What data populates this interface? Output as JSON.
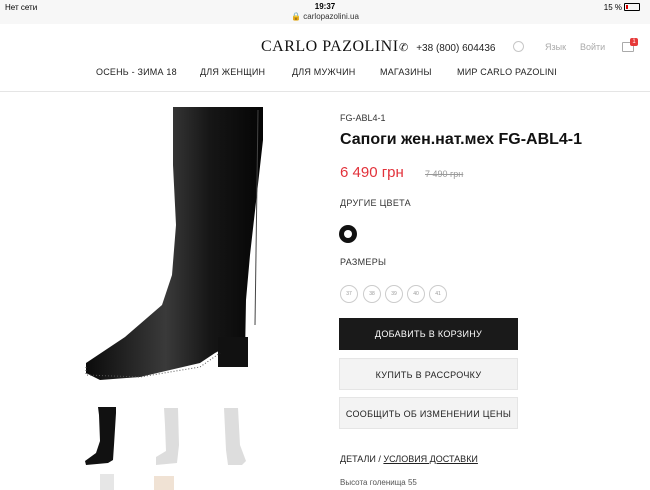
{
  "statusbar": {
    "carrier": "Нет сети",
    "time": "19:37",
    "url": "carlopazolini.ua",
    "battery": "15 %"
  },
  "header": {
    "logo": "CARLO PAZOLINI",
    "phone": "+38 (800) 604436",
    "lang": "Язык",
    "login": "Войти",
    "cart_count": "1"
  },
  "nav": [
    "ОСЕНЬ - ЗИМА 18",
    "ДЛЯ ЖЕНЩИН",
    "ДЛЯ МУЖЧИН",
    "МАГАЗИНЫ",
    "МИР CARLO PAZOLINI"
  ],
  "product": {
    "sku": "FG-ABL4-1",
    "title": "Сапоги жен.нат.мех FG-ABL4-1",
    "price": "6 490 грн",
    "old_price": "7 490 грн",
    "colors_label": "ДРУГИЕ ЦВЕТА",
    "sizes_label": "РАЗМЕРЫ",
    "sizes": [
      "37",
      "38",
      "39",
      "40",
      "41"
    ],
    "add_to_cart": "ДОБАВИТЬ В КОРЗИНУ",
    "installment": "КУПИТЬ В РАССРОЧКУ",
    "price_alert": "СООБЩИТЬ ОБ ИЗМЕНЕНИИ ЦЕНЫ",
    "details_link": "ДЕТАЛИ",
    "delivery_link": "УСЛОВИЯ ДОСТАВКИ",
    "description_partial": "Высота голенища 55"
  },
  "colors": {
    "price": "#e2313a",
    "dark_button": "#1a1a1a"
  }
}
